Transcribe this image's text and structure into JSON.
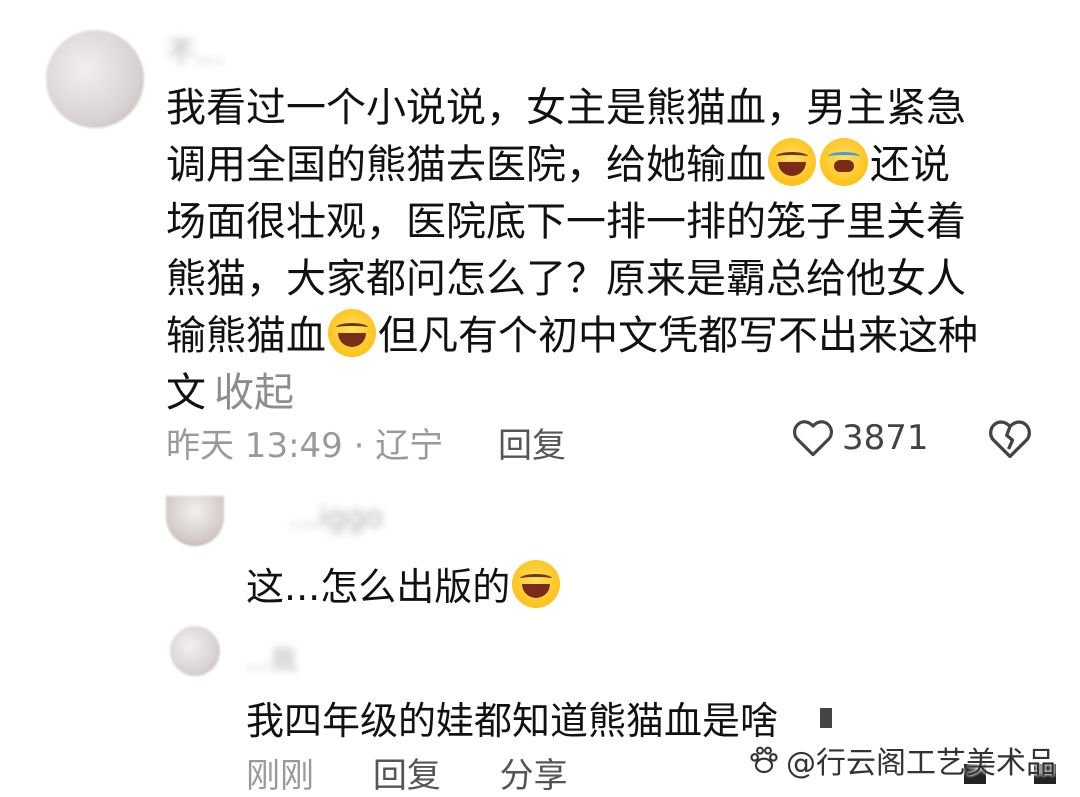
{
  "comment": {
    "author_blurred": "不...",
    "lines": [
      "我看过一个小说说，女主是熊猫血，男主紧急",
      "调用全国的熊猫去医院，给她输血",
      "还说",
      "场面很壮观，医院底下一排一排的笼子里关着",
      "熊猫，大家都问怎么了？原来是霸总给他女人",
      "输熊猫血",
      "但凡有个初中文凭都写不出来这种",
      "文"
    ],
    "collapse_label": "收起",
    "timestamp": "昨天 13:49 · 辽宁",
    "reply_label": "回复",
    "like_count": "3871",
    "icons": {
      "like": "heart-outline-icon",
      "dislike": "broken-heart-icon",
      "emoji": "rofl-emoji"
    }
  },
  "replies": [
    {
      "author_blurred": "...iggo",
      "text": "这...怎么出版的"
    },
    {
      "author_blurred": "...我",
      "text": "我四年级的娃都知道熊猫血是啥"
    }
  ],
  "footer": {
    "time_label": "刚刚",
    "reply_label": "回复",
    "share_label": "分享"
  },
  "watermark": "@行云阁工艺美术品"
}
